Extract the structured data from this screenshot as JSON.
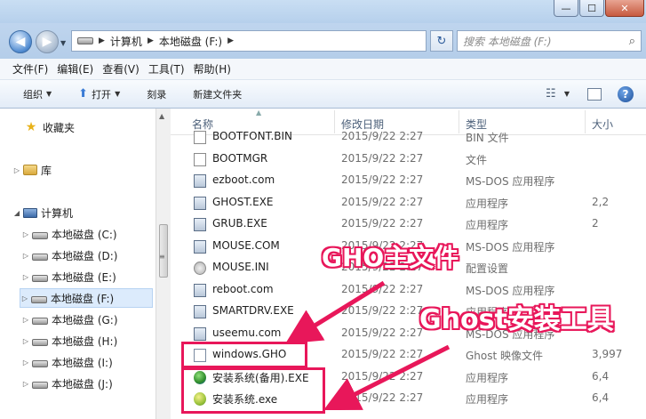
{
  "window": {
    "min_label": "—",
    "max_label": "☐",
    "close_label": "✕"
  },
  "address": {
    "crumbs": [
      "计算机",
      "本地磁盘 (F:)"
    ],
    "refresh_icon": "↻",
    "search_placeholder": "搜索 本地磁盘 (F:)",
    "search_icon": "⌕"
  },
  "menu": [
    "文件(F)",
    "编辑(E)",
    "查看(V)",
    "工具(T)",
    "帮助(H)"
  ],
  "toolbar": {
    "organize": "组织",
    "open": "打开",
    "burn": "刻录",
    "new_folder": "新建文件夹",
    "help_icon": "?"
  },
  "nav": {
    "favorites": "收藏夹",
    "libraries": "库",
    "computer": "计算机",
    "drives": [
      "本地磁盘 (C:)",
      "本地磁盘 (D:)",
      "本地磁盘 (E:)",
      "本地磁盘 (F:)",
      "本地磁盘 (G:)",
      "本地磁盘 (H:)",
      "本地磁盘 (I:)",
      "本地磁盘 (J:)"
    ],
    "selected_drive": "本地磁盘 (F:)"
  },
  "columns": [
    "名称",
    "修改日期",
    "类型",
    "大小"
  ],
  "files": [
    {
      "name": "BOOTFONT.BIN",
      "date": "2015/9/22 2:27",
      "type": "BIN 文件",
      "size": "",
      "icon": "blank-file-icon"
    },
    {
      "name": "BOOTMGR",
      "date": "2015/9/22 2:27",
      "type": "文件",
      "size": "",
      "icon": "blank-file-icon"
    },
    {
      "name": "ezboot.com",
      "date": "2015/9/22 2:27",
      "type": "MS-DOS 应用程序",
      "size": "",
      "icon": "exe-icon"
    },
    {
      "name": "GHOST.EXE",
      "date": "2015/9/22 2:27",
      "type": "应用程序",
      "size": "2,2",
      "icon": "exe-icon"
    },
    {
      "name": "GRUB.EXE",
      "date": "2015/9/22 2:27",
      "type": "应用程序",
      "size": "2",
      "icon": "exe-icon"
    },
    {
      "name": "MOUSE.COM",
      "date": "2015/9/22 2:27",
      "type": "MS-DOS 应用程序",
      "size": "",
      "icon": "exe-icon"
    },
    {
      "name": "MOUSE.INI",
      "date": "2015/9/22 2:27",
      "type": "配置设置",
      "size": "",
      "icon": "settings-file-icon"
    },
    {
      "name": "reboot.com",
      "date": "2015/9/22 2:27",
      "type": "MS-DOS 应用程序",
      "size": "",
      "icon": "exe-icon"
    },
    {
      "name": "SMARTDRV.EXE",
      "date": "2015/9/22 2:27",
      "type": "应用程序",
      "size": "",
      "icon": "exe-icon"
    },
    {
      "name": "useemu.com",
      "date": "2015/9/22 2:27",
      "type": "MS-DOS 应用程序",
      "size": "",
      "icon": "exe-icon"
    },
    {
      "name": "windows.GHO",
      "date": "2015/9/22 2:27",
      "type": "Ghost 映像文件",
      "size": "3,997",
      "icon": "gho-file-icon"
    },
    {
      "name": "安装系统(备用).EXE",
      "date": "2015/9/22 2:27",
      "type": "应用程序",
      "size": "6,4",
      "icon": "setup-app-icon"
    },
    {
      "name": "安装系统.exe",
      "date": "2015/9/22 2:27",
      "type": "应用程序",
      "size": "6,4",
      "icon": "setup-app-icon-2"
    }
  ],
  "annotations": {
    "gho_label": "GHO主文件",
    "ghost_label": "Ghost安装工具",
    "accent_color": "#e8175a"
  }
}
